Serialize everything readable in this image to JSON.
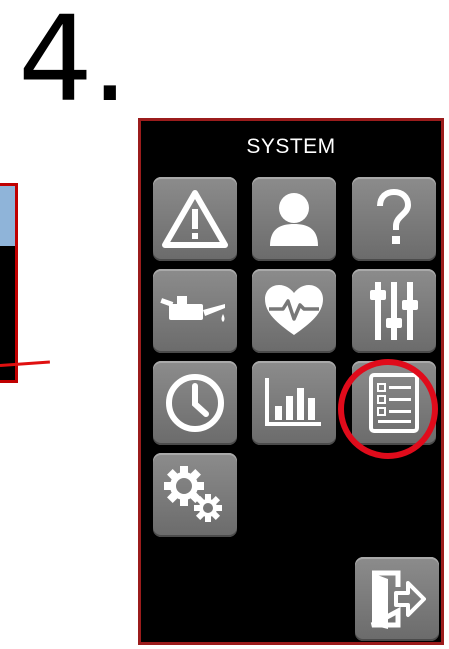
{
  "step": {
    "number": "4."
  },
  "screen": {
    "title": "SYSTEM",
    "accent_color": "#e00b1b",
    "tiles": [
      {
        "icon": "warning-icon"
      },
      {
        "icon": "user-icon"
      },
      {
        "icon": "help-icon"
      },
      {
        "icon": "oil-can-icon"
      },
      {
        "icon": "heartbeat-icon"
      },
      {
        "icon": "sliders-icon"
      },
      {
        "icon": "clock-icon"
      },
      {
        "icon": "bar-chart-icon"
      },
      {
        "icon": "checklist-icon",
        "highlighted": true
      },
      {
        "icon": "gears-icon"
      },
      {
        "icon": "exit-icon"
      }
    ]
  }
}
